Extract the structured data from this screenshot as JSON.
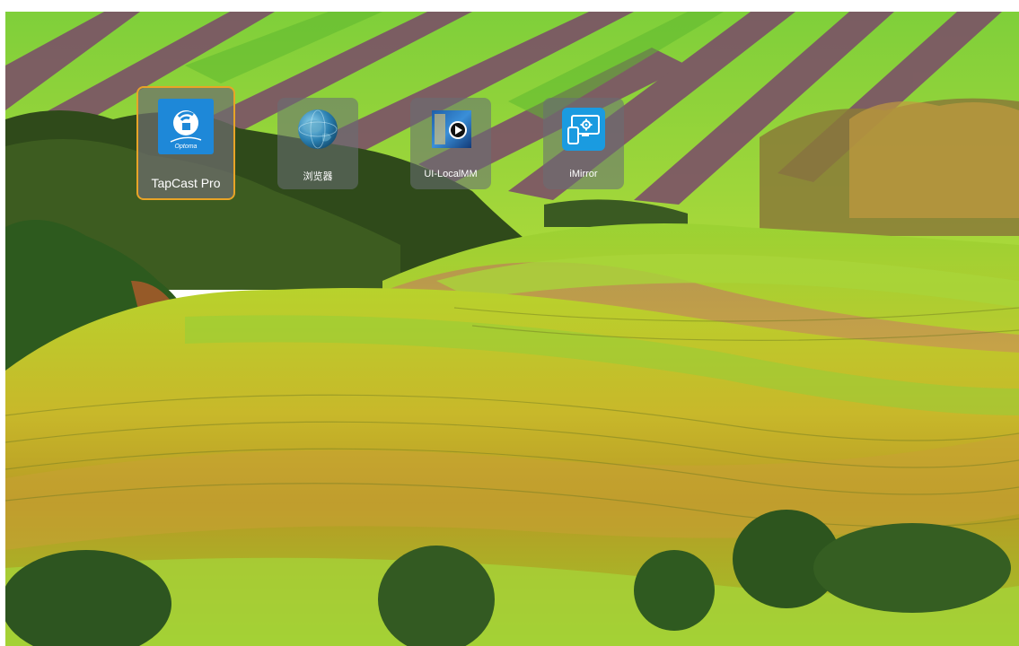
{
  "launcher": {
    "apps": [
      {
        "label": "TapCast Pro",
        "icon": "tapcast-pro-icon",
        "focused": true,
        "brand_text": "Optoma"
      },
      {
        "label": "浏览器",
        "icon": "globe-browser-icon",
        "focused": false
      },
      {
        "label": "UI-LocalMM",
        "icon": "media-player-icon",
        "focused": false
      },
      {
        "label": "iMirror",
        "icon": "screen-mirror-icon",
        "focused": false
      }
    ]
  },
  "colors": {
    "focus_border": "#e8a427",
    "tapcast_blue": "#1e88d8",
    "imirror_blue": "#1a9be0"
  }
}
